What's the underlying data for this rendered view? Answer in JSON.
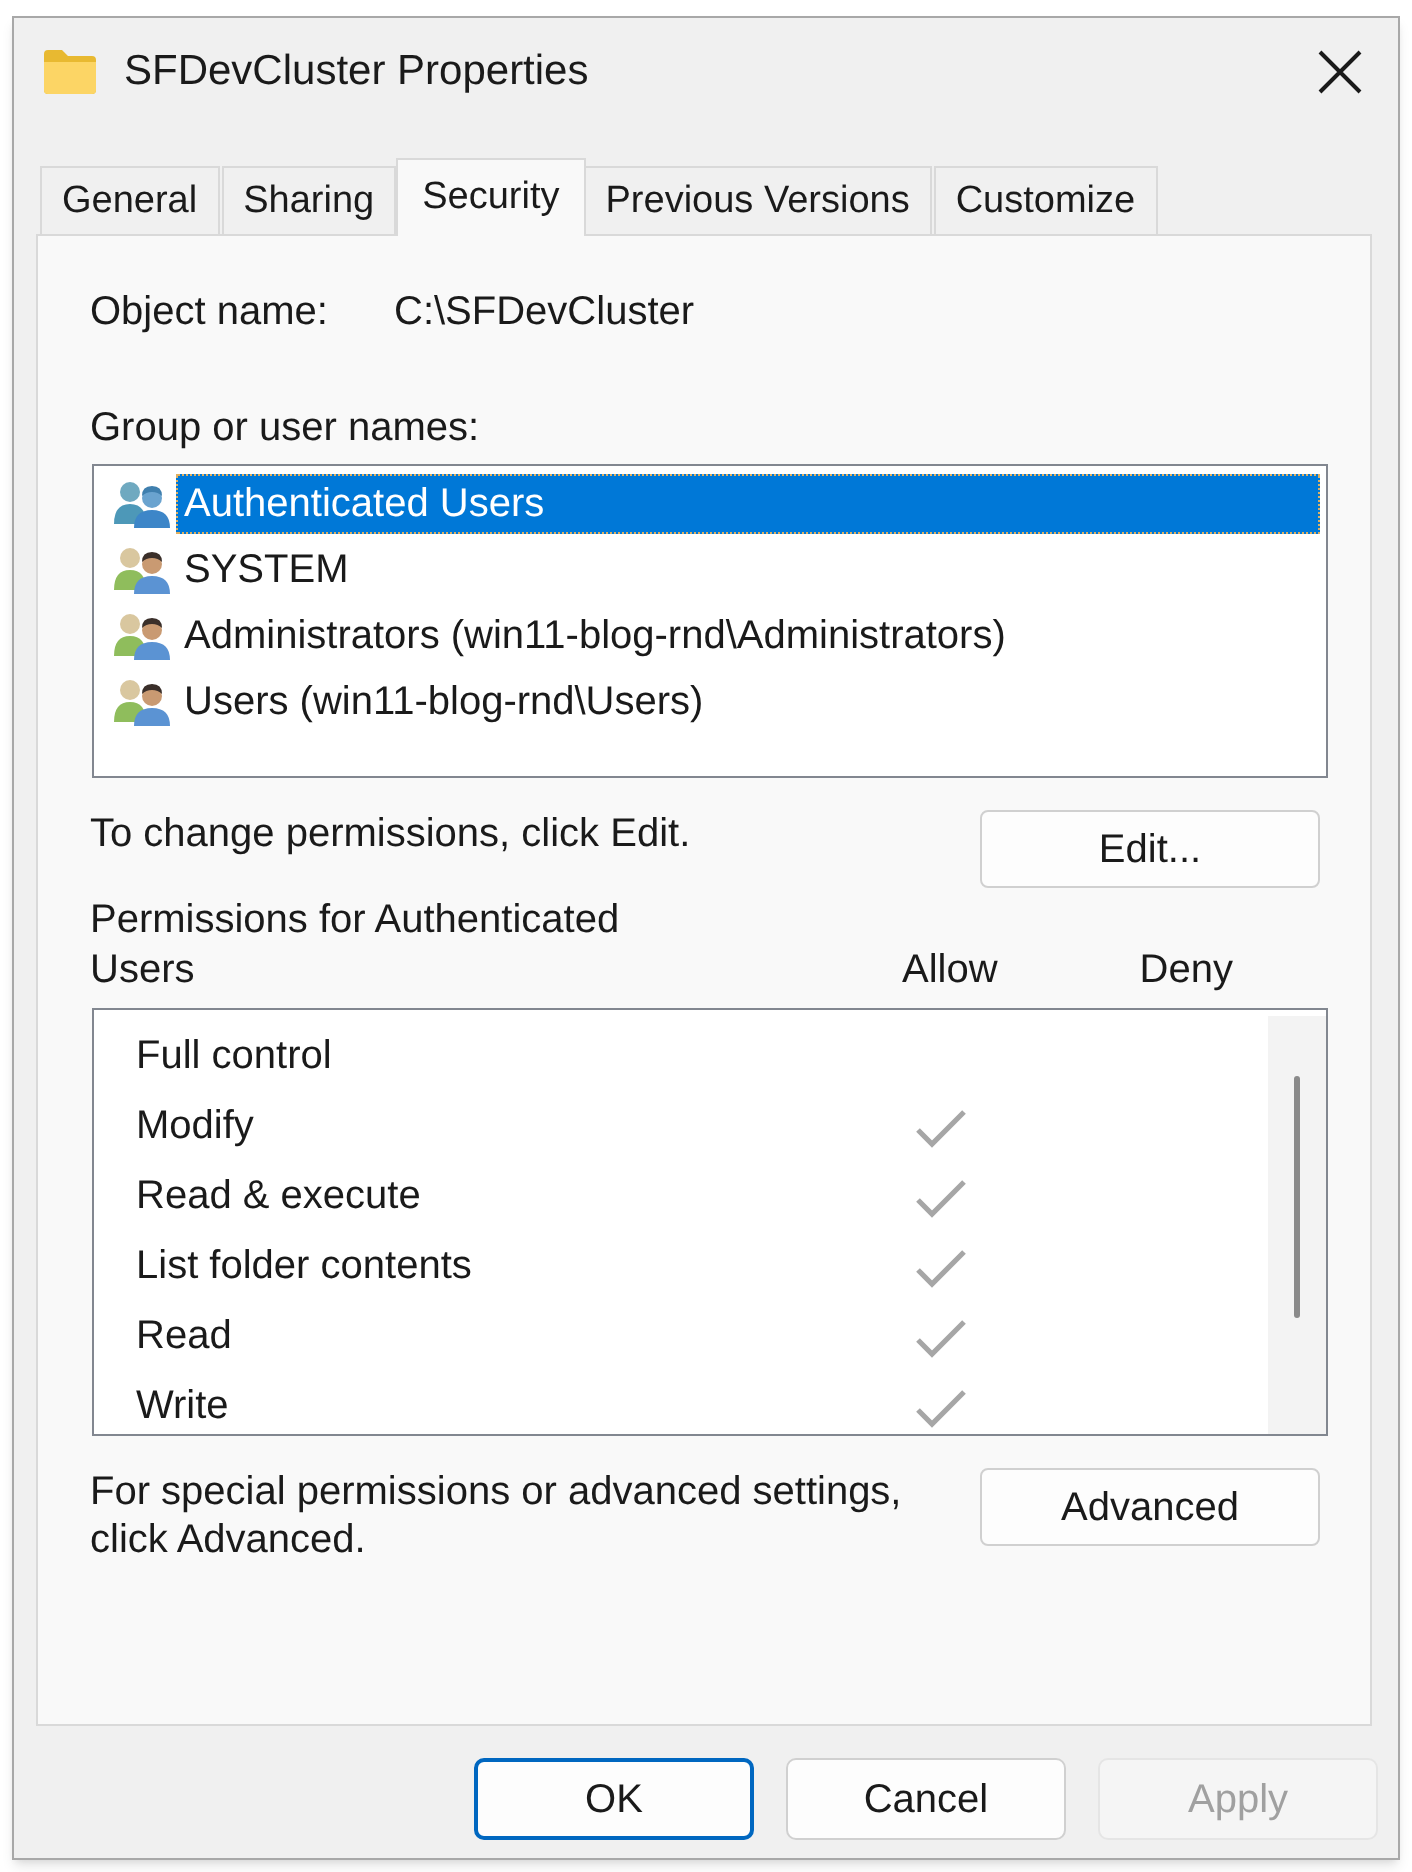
{
  "window": {
    "title": "SFDevCluster Properties"
  },
  "tabs": [
    {
      "label": "General",
      "selected": false
    },
    {
      "label": "Sharing",
      "selected": false
    },
    {
      "label": "Security",
      "selected": true
    },
    {
      "label": "Previous Versions",
      "selected": false
    },
    {
      "label": "Customize",
      "selected": false
    }
  ],
  "object_name": {
    "label": "Object name:",
    "value": "C:\\SFDevCluster"
  },
  "group_list": {
    "label": "Group or user names:",
    "items": [
      {
        "name": "Authenticated Users",
        "selected": true
      },
      {
        "name": "SYSTEM",
        "selected": false
      },
      {
        "name": "Administrators (win11-blog-rnd\\Administrators)",
        "selected": false
      },
      {
        "name": "Users (win11-blog-rnd\\Users)",
        "selected": false
      }
    ]
  },
  "edit_hint": "To change permissions, click Edit.",
  "edit_button": "Edit...",
  "permissions": {
    "title": "Permissions for Authenticated Users",
    "columns": [
      "Allow",
      "Deny"
    ],
    "rows": [
      {
        "name": "Full control",
        "allow": false
      },
      {
        "name": "Modify",
        "allow": true
      },
      {
        "name": "Read & execute",
        "allow": true
      },
      {
        "name": "List folder contents",
        "allow": true
      },
      {
        "name": "Read",
        "allow": true
      },
      {
        "name": "Write",
        "allow": true
      }
    ]
  },
  "advanced_hint": "For special permissions or advanced settings, click Advanced.",
  "advanced_button": "Advanced",
  "buttons": [
    {
      "label": "OK",
      "default": true,
      "disabled": false
    },
    {
      "label": "Cancel",
      "default": false,
      "disabled": false
    },
    {
      "label": "Apply",
      "default": false,
      "disabled": true
    }
  ]
}
